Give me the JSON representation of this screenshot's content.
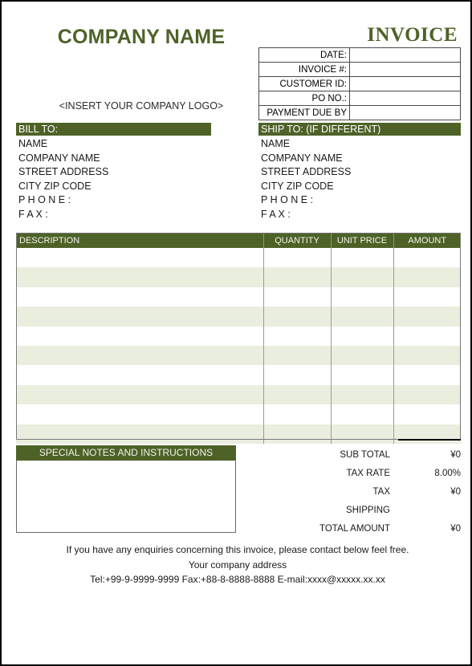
{
  "header": {
    "company_name": "COMPANY NAME",
    "invoice_word": "INVOICE",
    "logo_placeholder": "<INSERT YOUR COMPANY LOGO>"
  },
  "invoice_info": {
    "rows": [
      {
        "label": "DATE:",
        "value": ""
      },
      {
        "label": "INVOICE #:",
        "value": ""
      },
      {
        "label": "CUSTOMER ID:",
        "value": ""
      },
      {
        "label": "PO NO.:",
        "value": ""
      },
      {
        "label": "PAYMENT DUE BY",
        "value": ""
      }
    ]
  },
  "bill_to": {
    "title": "BILL TO:",
    "lines": [
      "NAME",
      "COMPANY NAME",
      "STREET ADDRESS",
      "CITY ZIP CODE",
      "P H O N E :",
      "F A X :"
    ]
  },
  "ship_to": {
    "title": "SHIP TO: (IF DIFFERENT)",
    "lines": [
      "NAME",
      "COMPANY NAME",
      "STREET ADDRESS",
      "CITY ZIP CODE",
      "P H O N E :",
      "F A X :"
    ]
  },
  "items_table": {
    "columns": [
      "DESCRIPTION",
      "QUANTITY",
      "UNIT PRICE",
      "AMOUNT"
    ],
    "rows": [
      {
        "description": "",
        "quantity": "",
        "unit_price": "",
        "amount": ""
      },
      {
        "description": "",
        "quantity": "",
        "unit_price": "",
        "amount": ""
      },
      {
        "description": "",
        "quantity": "",
        "unit_price": "",
        "amount": ""
      },
      {
        "description": "",
        "quantity": "",
        "unit_price": "",
        "amount": ""
      },
      {
        "description": "",
        "quantity": "",
        "unit_price": "",
        "amount": ""
      },
      {
        "description": "",
        "quantity": "",
        "unit_price": "",
        "amount": ""
      },
      {
        "description": "",
        "quantity": "",
        "unit_price": "",
        "amount": ""
      },
      {
        "description": "",
        "quantity": "",
        "unit_price": "",
        "amount": ""
      },
      {
        "description": "",
        "quantity": "",
        "unit_price": "",
        "amount": ""
      },
      {
        "description": "",
        "quantity": "",
        "unit_price": "",
        "amount": ""
      }
    ]
  },
  "notes": {
    "title": "SPECIAL NOTES AND INSTRUCTIONS",
    "content": ""
  },
  "totals": {
    "rows": [
      {
        "label": "SUB TOTAL",
        "value": "¥0"
      },
      {
        "label": "TAX RATE",
        "value": "8.00%"
      },
      {
        "label": "TAX",
        "value": "¥0"
      },
      {
        "label": "SHIPPING",
        "value": ""
      },
      {
        "label": "TOTAL AMOUNT",
        "value": "¥0"
      }
    ]
  },
  "footer": {
    "line1": "If you have any enquiries concerning this invoice, please contact below feel free.",
    "line2": "Your company address",
    "line3": "Tel:+99-9-9999-9999 Fax:+88-8-8888-8888 E-mail:xxxx@xxxxx.xx.xx"
  },
  "colors": {
    "accent_green": "#4E6228",
    "title_green": "#4F6228",
    "row_stripe": "#EAEEDF"
  }
}
